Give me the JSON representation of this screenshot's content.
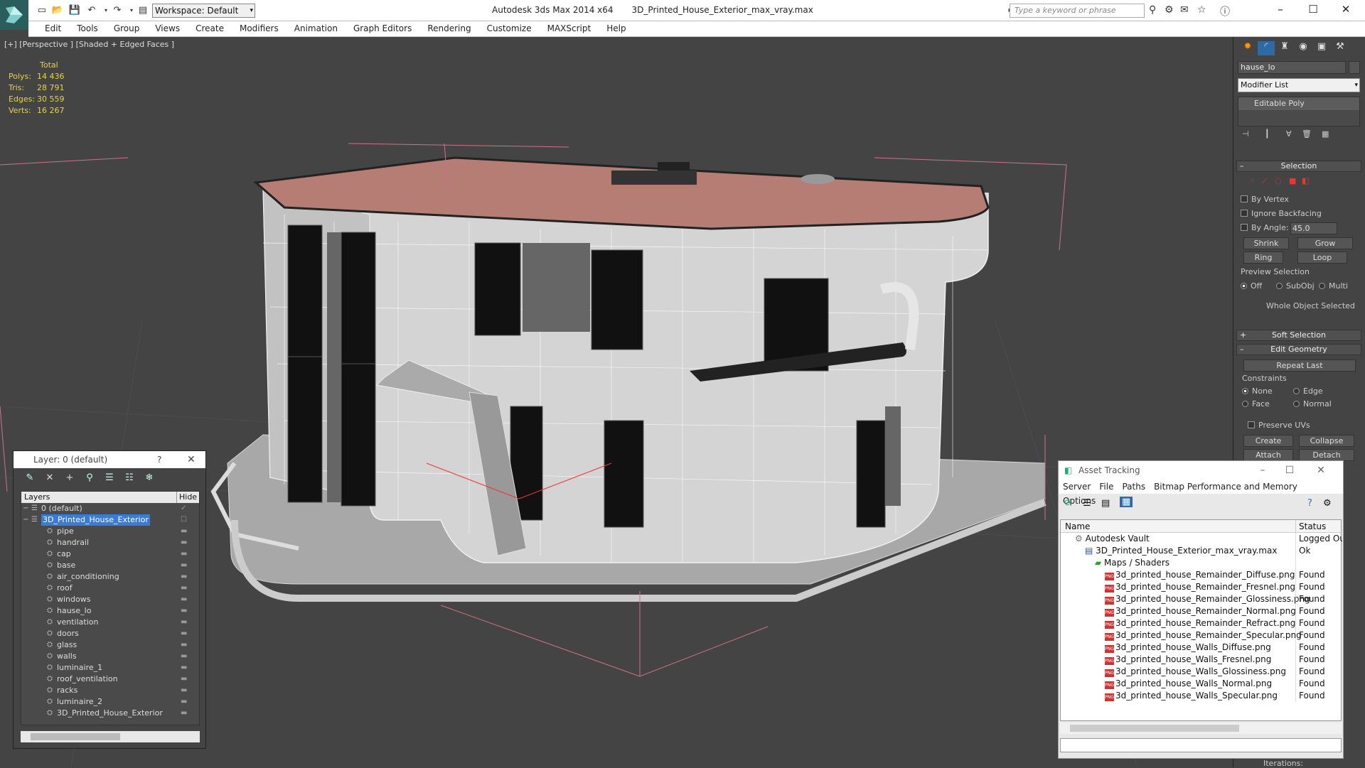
{
  "app": {
    "name": "Autodesk 3ds Max  2014 x64",
    "file": "3D_Printed_House_Exterior_max_vray.max",
    "workspace": "Workspace: Default",
    "search_placeholder": "Type a keyword or phrase"
  },
  "menu": [
    "Edit",
    "Tools",
    "Group",
    "Views",
    "Create",
    "Modifiers",
    "Animation",
    "Graph Editors",
    "Rendering",
    "Customize",
    "MAXScript",
    "Help"
  ],
  "viewport": {
    "label": "[+] [Perspective ] [Shaded + Edged Faces ]",
    "stats_header": "Total",
    "stats": [
      {
        "k": "Polys:",
        "v": "14 436"
      },
      {
        "k": "Tris:",
        "v": "28 791"
      },
      {
        "k": "Edges:",
        "v": "30 559"
      },
      {
        "k": "Verts:",
        "v": "16 267"
      }
    ]
  },
  "command_panel": {
    "object_name": "hause_lo",
    "modifier_list": "Modifier List",
    "stack_item": "Editable Poly",
    "selection": {
      "title": "Selection",
      "by_vertex": "By Vertex",
      "ignore_backfacing": "Ignore Backfacing",
      "by_angle": "By Angle:",
      "angle_value": "45.0",
      "shrink": "Shrink",
      "grow": "Grow",
      "ring": "Ring",
      "loop": "Loop",
      "preview_selection": "Preview Selection",
      "off": "Off",
      "subobj": "SubObj",
      "multi": "Multi",
      "status": "Whole Object Selected"
    },
    "soft_selection": "Soft Selection",
    "edit_geometry": {
      "title": "Edit Geometry",
      "repeat_last": "Repeat Last",
      "constraints": "Constraints",
      "none": "None",
      "edge": "Edge",
      "face": "Face",
      "normal": "Normal",
      "preserve_uvs": "Preserve UVs",
      "create": "Create",
      "collapse": "Collapse",
      "attach": "Attach",
      "detach": "Detach"
    },
    "iterations": "Iterations:"
  },
  "layer_window": {
    "title": "Layer: 0 (default)",
    "help": "?",
    "col_layers": "Layers",
    "col_hide": "Hide",
    "rows": [
      {
        "name": "0 (default)",
        "level": 0,
        "selected": false,
        "icon": "layer"
      },
      {
        "name": "3D_Printed_House_Exterior",
        "level": 0,
        "selected": true,
        "icon": "layer"
      },
      {
        "name": "pipe",
        "level": 1,
        "selected": false,
        "icon": "object"
      },
      {
        "name": "handrail",
        "level": 1,
        "selected": false,
        "icon": "object"
      },
      {
        "name": "cap",
        "level": 1,
        "selected": false,
        "icon": "object"
      },
      {
        "name": "base",
        "level": 1,
        "selected": false,
        "icon": "object"
      },
      {
        "name": "air_conditioning",
        "level": 1,
        "selected": false,
        "icon": "object"
      },
      {
        "name": "roof",
        "level": 1,
        "selected": false,
        "icon": "object"
      },
      {
        "name": "windows",
        "level": 1,
        "selected": false,
        "icon": "object"
      },
      {
        "name": "hause_lo",
        "level": 1,
        "selected": false,
        "icon": "object"
      },
      {
        "name": "ventilation",
        "level": 1,
        "selected": false,
        "icon": "object"
      },
      {
        "name": "doors",
        "level": 1,
        "selected": false,
        "icon": "object"
      },
      {
        "name": "glass",
        "level": 1,
        "selected": false,
        "icon": "object"
      },
      {
        "name": "walls",
        "level": 1,
        "selected": false,
        "icon": "object"
      },
      {
        "name": "luminaire_1",
        "level": 1,
        "selected": false,
        "icon": "object"
      },
      {
        "name": "roof_ventilation",
        "level": 1,
        "selected": false,
        "icon": "object"
      },
      {
        "name": "racks",
        "level": 1,
        "selected": false,
        "icon": "object"
      },
      {
        "name": "luminaire_2",
        "level": 1,
        "selected": false,
        "icon": "object"
      },
      {
        "name": "3D_Printed_House_Exterior",
        "level": 1,
        "selected": false,
        "icon": "object"
      }
    ]
  },
  "asset_window": {
    "title": "Asset Tracking",
    "menu": [
      "Server",
      "File",
      "Paths",
      "Bitmap Performance and Memory",
      "Options"
    ],
    "col_name": "Name",
    "col_status": "Status",
    "rows": [
      {
        "name": "Autodesk Vault",
        "status": "Logged Ou",
        "level": 0,
        "icon": "vault"
      },
      {
        "name": "3D_Printed_House_Exterior_max_vray.max",
        "status": "Ok",
        "level": 1,
        "icon": "max"
      },
      {
        "name": "Maps / Shaders",
        "status": "",
        "level": 2,
        "icon": "folder"
      },
      {
        "name": "3d_printed_house_Remainder_Diffuse.png",
        "status": "Found",
        "level": 3,
        "icon": "png"
      },
      {
        "name": "3d_printed_house_Remainder_Fresnel.png",
        "status": "Found",
        "level": 3,
        "icon": "png"
      },
      {
        "name": "3d_printed_house_Remainder_Glossiness.png",
        "status": "Found",
        "level": 3,
        "icon": "png"
      },
      {
        "name": "3d_printed_house_Remainder_Normal.png",
        "status": "Found",
        "level": 3,
        "icon": "png"
      },
      {
        "name": "3d_printed_house_Remainder_Refract.png",
        "status": "Found",
        "level": 3,
        "icon": "png"
      },
      {
        "name": "3d_printed_house_Remainder_Specular.png",
        "status": "Found",
        "level": 3,
        "icon": "png"
      },
      {
        "name": "3d_printed_house_Walls_Diffuse.png",
        "status": "Found",
        "level": 3,
        "icon": "png"
      },
      {
        "name": "3d_printed_house_Walls_Fresnel.png",
        "status": "Found",
        "level": 3,
        "icon": "png"
      },
      {
        "name": "3d_printed_house_Walls_Glossiness.png",
        "status": "Found",
        "level": 3,
        "icon": "png"
      },
      {
        "name": "3d_printed_house_Walls_Normal.png",
        "status": "Found",
        "level": 3,
        "icon": "png"
      },
      {
        "name": "3d_printed_house_Walls_Specular.png",
        "status": "Found",
        "level": 3,
        "icon": "png"
      }
    ]
  },
  "colors": {
    "viewport_bg": "#444444",
    "stats_text": "#e8d24a",
    "selection_blue": "#3a7bd5",
    "roof": "#b57d74",
    "bbox_lines": "#d0708a"
  }
}
